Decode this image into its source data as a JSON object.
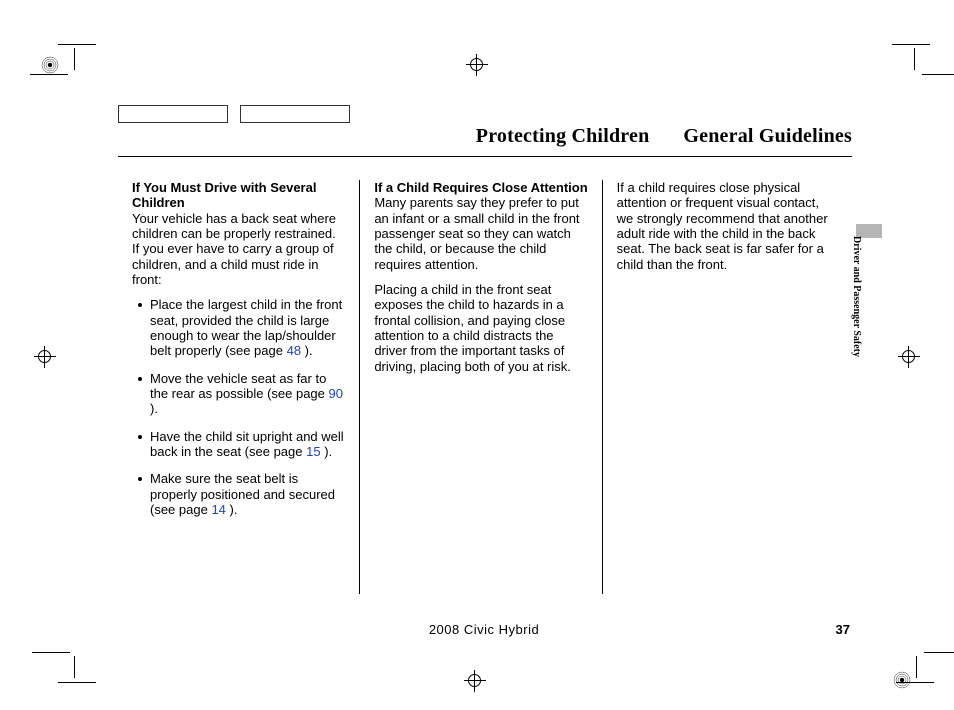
{
  "header": {
    "title_left": "Protecting Children",
    "title_right": "General Guidelines"
  },
  "side_tab": "Driver and Passenger Safety",
  "col1": {
    "heading": "If You Must Drive with Several Children",
    "intro": "Your vehicle has a back seat where children can be properly restrained. If you ever have to carry a group of children, and a child must ride in front:",
    "bullets": [
      {
        "pre": "Place the largest child in the front seat, provided the child is large enough to wear the lap/shoulder belt properly (see page ",
        "link": "48",
        "post": " )."
      },
      {
        "pre": "Move the vehicle seat as far to the rear as possible (see page  ",
        "link": "90",
        "post": "  )."
      },
      {
        "pre": "Have the child sit upright and well back in the seat (see page ",
        "link": "15",
        "post": " )."
      },
      {
        "pre": "Make sure the seat belt is properly positioned and secured (see page ",
        "link": "14",
        "post": " )."
      }
    ]
  },
  "col2": {
    "heading": "If a Child Requires Close Attention",
    "p1": "Many parents say they prefer to put an infant or a small child in the front passenger seat so they can watch the child, or because the child requires attention.",
    "p2": "Placing a child in the front seat exposes the child to hazards in a frontal collision, and paying close attention to a child distracts the driver from the important tasks of driving, placing both of you at risk."
  },
  "col3": {
    "p1": "If a child requires close physical attention or frequent visual contact, we strongly recommend that another adult ride with the child in the back seat. The back seat is far safer for a child than the front."
  },
  "footer": {
    "model": "2008  Civic  Hybrid",
    "page": "37"
  }
}
